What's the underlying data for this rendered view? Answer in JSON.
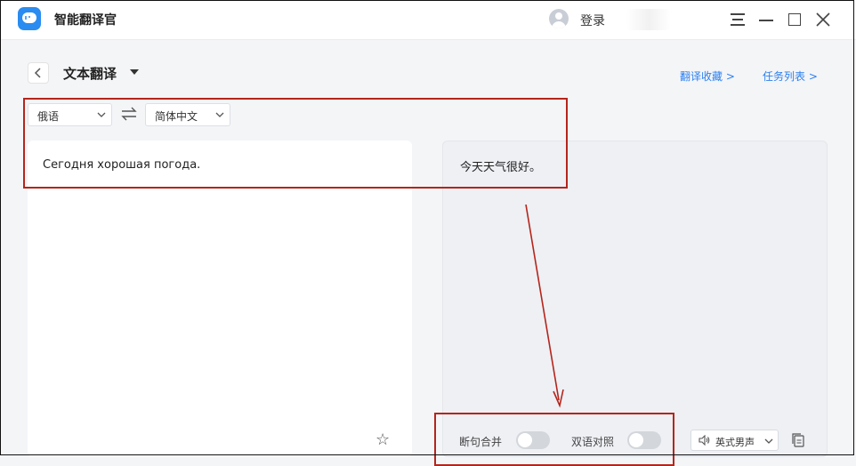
{
  "app": {
    "title": "智能翻译官",
    "login_label": "登录",
    "accent": "#2a8cf0"
  },
  "header": {
    "title": "文本翻译",
    "favorites_link": "翻译收藏 >",
    "task_list_link": "任务列表 >"
  },
  "languages": {
    "source": "俄语",
    "target": "简体中文"
  },
  "source_text": "Сегодня хорошая погода.",
  "translated_text": "今天天气很好。",
  "controls": {
    "sentence_merge_label": "断句合并",
    "sentence_merge_on": false,
    "bilingual_label": "双语对照",
    "bilingual_on": false,
    "voice": "英式男声"
  },
  "annotation_color": "#b5251b"
}
